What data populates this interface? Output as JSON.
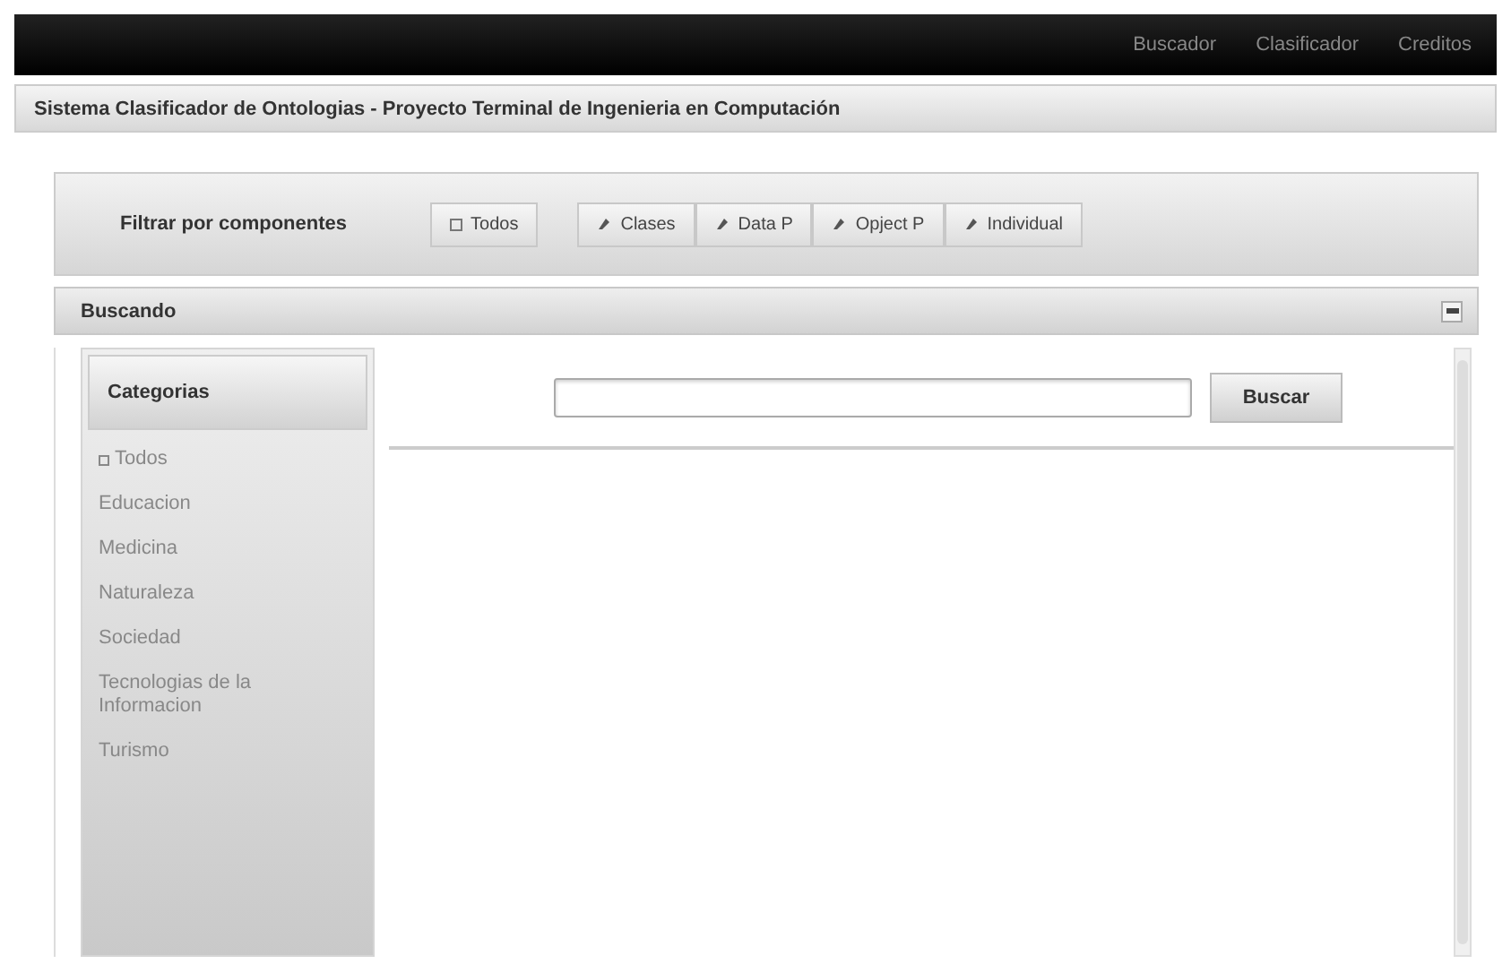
{
  "nav": {
    "links": [
      "Buscador",
      "Clasificador",
      "Creditos"
    ]
  },
  "header": {
    "title": "Sistema Clasificador de Ontologias - Proyecto Terminal de Ingenieria en Computación"
  },
  "filter": {
    "label": "Filtrar por componentes",
    "buttons": [
      {
        "label": "Todos",
        "kind": "all"
      },
      {
        "label": "Clases",
        "kind": "component"
      },
      {
        "label": "Data P",
        "kind": "component"
      },
      {
        "label": "Opject P",
        "kind": "component"
      },
      {
        "label": "Individual",
        "kind": "component"
      }
    ]
  },
  "panel": {
    "title": "Buscando",
    "sidebar": {
      "title": "Categorias",
      "items": [
        {
          "label": "Todos",
          "kind": "all"
        },
        {
          "label": "Educacion",
          "kind": "plain"
        },
        {
          "label": "Medicina",
          "kind": "plain"
        },
        {
          "label": "Naturaleza",
          "kind": "plain"
        },
        {
          "label": "Sociedad",
          "kind": "plain"
        },
        {
          "label": "Tecnologias de la Informacion",
          "kind": "plain"
        },
        {
          "label": "Turismo",
          "kind": "plain"
        }
      ]
    },
    "search": {
      "button": "Buscar"
    }
  }
}
